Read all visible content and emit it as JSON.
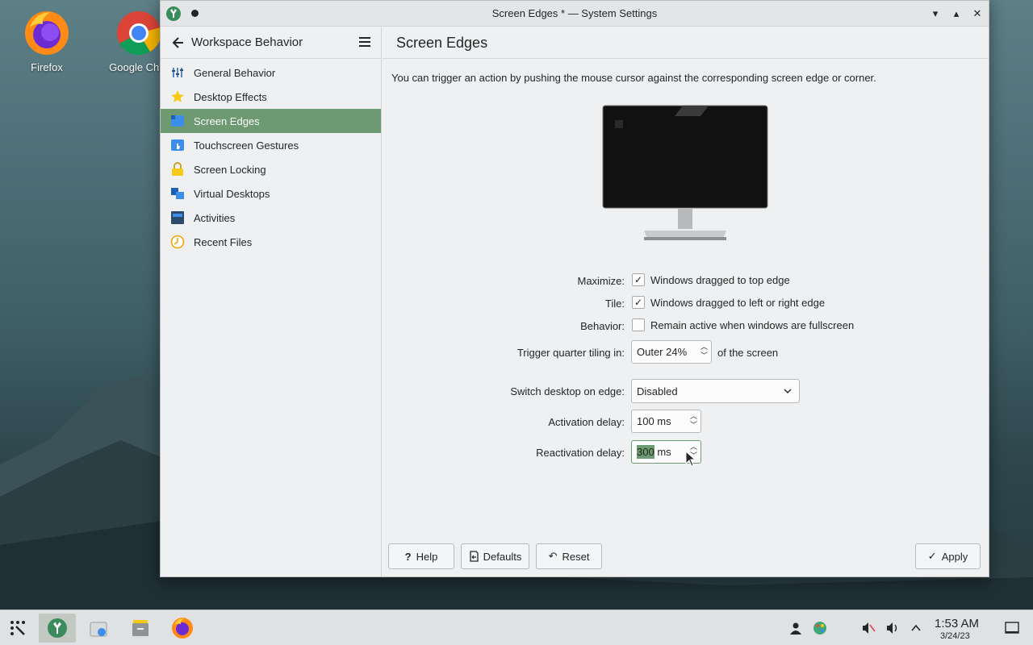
{
  "desktop": {
    "icons": [
      {
        "label": "Firefox"
      },
      {
        "label": "Google Chro"
      }
    ]
  },
  "window": {
    "title": "Screen Edges * — System Settings",
    "controls": [
      "minimize",
      "maximize",
      "close"
    ]
  },
  "sidebar": {
    "header": "Workspace Behavior",
    "items": [
      {
        "label": "General Behavior",
        "icon": "general-behavior-icon"
      },
      {
        "label": "Desktop Effects",
        "icon": "star-icon"
      },
      {
        "label": "Screen Edges",
        "icon": "screen-edges-icon",
        "selected": true
      },
      {
        "label": "Touchscreen Gestures",
        "icon": "touch-icon"
      },
      {
        "label": "Screen Locking",
        "icon": "lock-icon"
      },
      {
        "label": "Virtual Desktops",
        "icon": "virtual-desktops-icon"
      },
      {
        "label": "Activities",
        "icon": "activities-icon"
      },
      {
        "label": "Recent Files",
        "icon": "clock-icon"
      }
    ]
  },
  "main": {
    "title": "Screen Edges",
    "description": "You can trigger an action by pushing the mouse cursor against the corresponding screen edge or corner.",
    "form": {
      "maximize": {
        "label": "Maximize:",
        "text": "Windows dragged to top edge",
        "checked": true
      },
      "tile": {
        "label": "Tile:",
        "text": "Windows dragged to left or right edge",
        "checked": true
      },
      "behavior": {
        "label": "Behavior:",
        "text": "Remain active when windows are fullscreen",
        "checked": false
      },
      "quarter": {
        "label": "Trigger quarter tiling in:",
        "value": "Outer 24%",
        "suffix": "of the screen"
      },
      "switch": {
        "label": "Switch desktop on edge:",
        "value": "Disabled"
      },
      "activation": {
        "label": "Activation delay:",
        "value": "100 ms"
      },
      "reactivation": {
        "label": "Reactivation delay:",
        "value_selected": "300",
        "unit": " ms"
      }
    },
    "buttons": {
      "help": "Help",
      "defaults": "Defaults",
      "reset": "Reset",
      "apply": "Apply"
    }
  },
  "taskbar": {
    "time": "1:53 AM",
    "date": "3/24/23"
  }
}
